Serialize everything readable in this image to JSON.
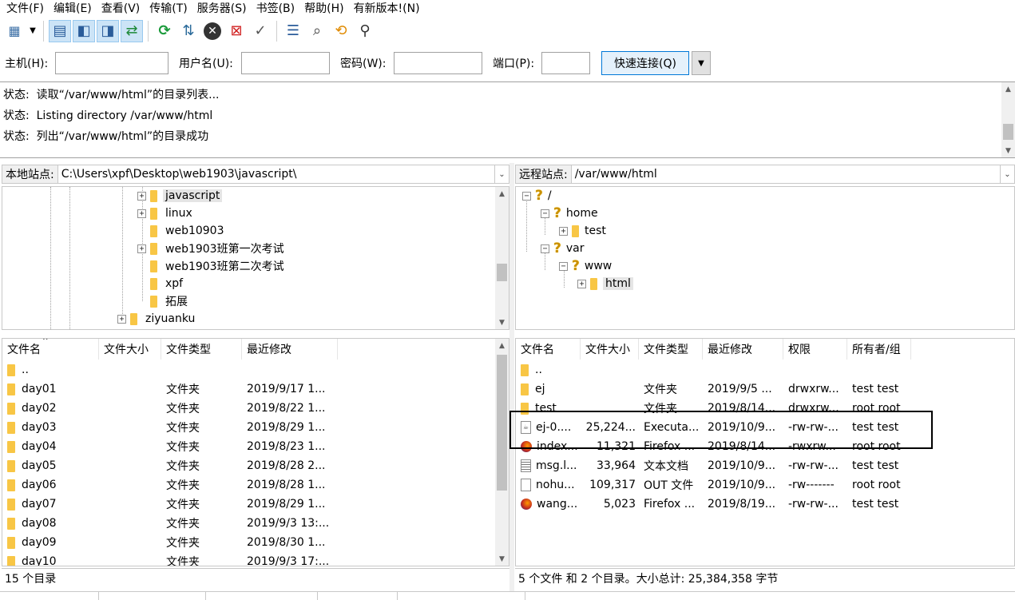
{
  "menu": [
    "文件(F)",
    "编辑(E)",
    "查看(V)",
    "传输(T)",
    "服务器(S)",
    "书签(B)",
    "帮助(H)",
    "有新版本!(N)"
  ],
  "toolbar_icons": [
    "site-manager-icon",
    "dropdown-icon",
    "toggle-log-icon",
    "toggle-local-tree-icon",
    "toggle-remote-tree-icon",
    "toggle-queue-icon",
    "refresh-icon",
    "process-queue-icon",
    "cancel-icon",
    "disconnect-icon",
    "reconnect-icon",
    "directory-compare-icon",
    "filter-icon",
    "sync-browse-icon",
    "search-icon"
  ],
  "quickconnect": {
    "host_label": "主机(H):",
    "user_label": "用户名(U):",
    "pass_label": "密码(W):",
    "port_label": "端口(P):",
    "connect_label": "快速连接(Q)",
    "host": "",
    "user": "",
    "pass": "",
    "port": ""
  },
  "log": [
    {
      "prefix": "状态:",
      "text": "读取“/var/www/html”的目录列表..."
    },
    {
      "prefix": "状态:",
      "text": "Listing directory /var/www/html"
    },
    {
      "prefix": "状态:",
      "text": "列出“/var/www/html”的目录成功"
    }
  ],
  "local": {
    "label": "本地站点:",
    "path": "C:\\Users\\xpf\\Desktop\\web1903\\javascript\\",
    "tree": [
      "javascript",
      "linux",
      "web10903",
      "web1903班第一次考试",
      "web1903班第二次考试",
      "xpf",
      "拓展",
      "ziyuanku"
    ],
    "headers": [
      "文件名",
      "文件大小",
      "文件类型",
      "最近修改"
    ],
    "files": [
      {
        "name": "..",
        "size": "",
        "type": "",
        "modified": ""
      },
      {
        "name": "day01",
        "size": "",
        "type": "文件夹",
        "modified": "2019/9/17 1..."
      },
      {
        "name": "day02",
        "size": "",
        "type": "文件夹",
        "modified": "2019/8/22 1..."
      },
      {
        "name": "day03",
        "size": "",
        "type": "文件夹",
        "modified": "2019/8/29 1..."
      },
      {
        "name": "day04",
        "size": "",
        "type": "文件夹",
        "modified": "2019/8/23 1..."
      },
      {
        "name": "day05",
        "size": "",
        "type": "文件夹",
        "modified": "2019/8/28 2..."
      },
      {
        "name": "day06",
        "size": "",
        "type": "文件夹",
        "modified": "2019/8/28 1..."
      },
      {
        "name": "day07",
        "size": "",
        "type": "文件夹",
        "modified": "2019/8/29 1..."
      },
      {
        "name": "day08",
        "size": "",
        "type": "文件夹",
        "modified": "2019/9/3 13:..."
      },
      {
        "name": "day09",
        "size": "",
        "type": "文件夹",
        "modified": "2019/8/30 1..."
      },
      {
        "name": "day10",
        "size": "",
        "type": "文件夹",
        "modified": "2019/9/3 17:..."
      }
    ],
    "status": "15 个目录"
  },
  "remote": {
    "label": "远程站点:",
    "path": "/var/www/html",
    "tree": [
      "/",
      "home",
      "test",
      "var",
      "www",
      "html"
    ],
    "headers": [
      "文件名",
      "文件大小",
      "文件类型",
      "最近修改",
      "权限",
      "所有者/组"
    ],
    "files": [
      {
        "name": "..",
        "size": "",
        "type": "",
        "modified": "",
        "perm": "",
        "owner": "",
        "icon": "folder"
      },
      {
        "name": "ej",
        "size": "",
        "type": "文件夹",
        "modified": "2019/9/5 ...",
        "perm": "drwxrw...",
        "owner": "test test",
        "icon": "folder"
      },
      {
        "name": "test",
        "size": "",
        "type": "文件夹",
        "modified": "2019/8/14...",
        "perm": "drwxrw...",
        "owner": "root root",
        "icon": "folder"
      },
      {
        "name": "ej-0....",
        "size": "25,224...",
        "type": "Executa...",
        "modified": "2019/10/9...",
        "perm": "-rw-rw-...",
        "owner": "test test",
        "icon": "exe"
      },
      {
        "name": "index...",
        "size": "11,321",
        "type": "Firefox ...",
        "modified": "2019/8/14...",
        "perm": "-rwxrw...",
        "owner": "root root",
        "icon": "firefox"
      },
      {
        "name": "msg.l...",
        "size": "33,964",
        "type": "文本文档",
        "modified": "2019/10/9...",
        "perm": "-rw-rw-...",
        "owner": "test test",
        "icon": "text"
      },
      {
        "name": "nohu...",
        "size": "109,317",
        "type": "OUT 文件",
        "modified": "2019/10/9...",
        "perm": "-rw-------",
        "owner": "root root",
        "icon": "blank"
      },
      {
        "name": "wang...",
        "size": "5,023",
        "type": "Firefox ...",
        "modified": "2019/8/19...",
        "perm": "-rw-rw-...",
        "owner": "test test",
        "icon": "firefox"
      }
    ],
    "status": "5 个文件 和 2 个目录。大小总计: 25,384,358 字节"
  }
}
